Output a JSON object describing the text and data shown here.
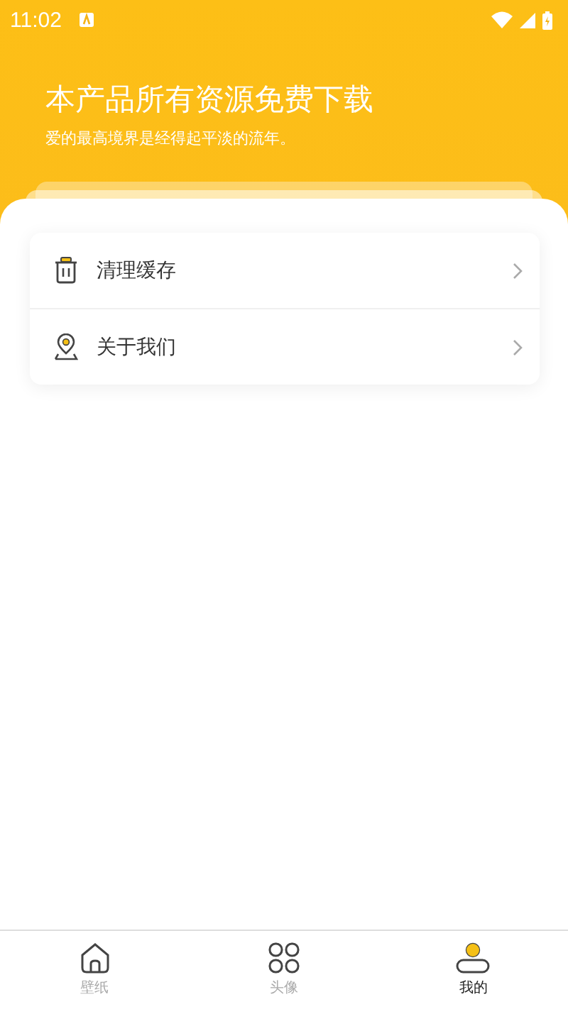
{
  "status_bar": {
    "time": "11:02"
  },
  "header": {
    "title": "本产品所有资源免费下载",
    "subtitle": "爱的最高境界是经得起平淡的流年。"
  },
  "menu": [
    {
      "kind": "trash",
      "label": "清理缓存"
    },
    {
      "kind": "location",
      "label": "关于我们"
    }
  ],
  "tabs": [
    {
      "kind": "home",
      "label": "壁纸",
      "selected": false
    },
    {
      "kind": "grid",
      "label": "头像",
      "selected": false
    },
    {
      "kind": "person",
      "label": "我的",
      "selected": true
    }
  ]
}
